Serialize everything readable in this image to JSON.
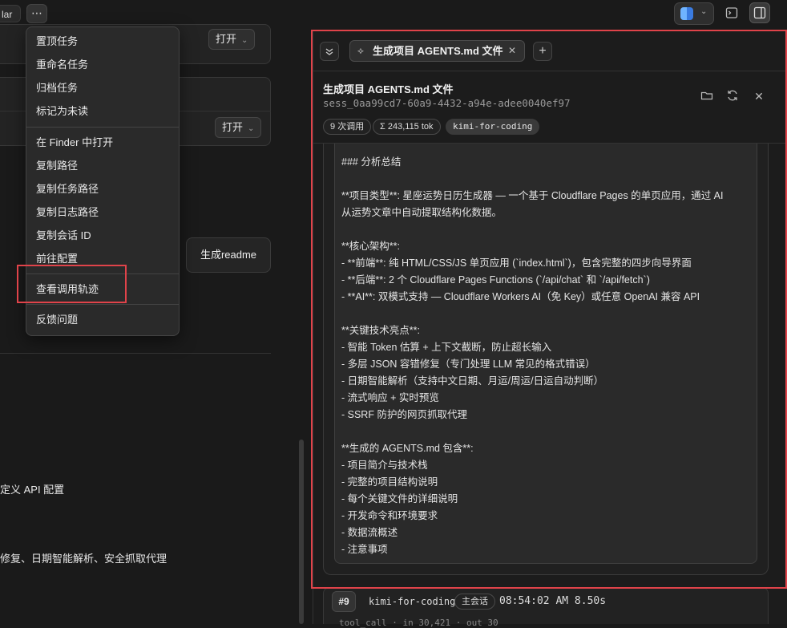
{
  "topbar": {
    "left_fragment": "lar",
    "more_label": "⋯"
  },
  "left": {
    "open_label_1": "打开",
    "open_label_2": "打开",
    "readme_button": "生成readme",
    "text_line_1": "定义 API 配置",
    "text_line_2": "修复、日期智能解析、安全抓取代理"
  },
  "menu": {
    "items": [
      "置顶任务",
      "重命名任务",
      "归档任务",
      "标记为未读",
      "在 Finder 中打开",
      "复制路径",
      "复制任务路径",
      "复制日志路径",
      "复制会话 ID",
      "前往配置",
      "查看调用轨迹",
      "反馈问题"
    ]
  },
  "panel": {
    "tab_label": "生成项目 AGENTS.md 文件",
    "session_title": "生成项目 AGENTS.md 文件",
    "session_id": "sess_0aa99cd7-60a9-4432-a94e-adee0040ef97",
    "badges": {
      "calls": "9 次调用",
      "tokens": "Σ 243,115 tok",
      "model": "kimi-for-coding"
    },
    "content_lines": [
      "### 分析总结",
      "",
      "**项目类型**: 星座运势日历生成器 — 一个基于 Cloudflare Pages 的单页应用，通过 AI",
      "从运势文章中自动提取结构化数据。",
      "",
      "**核心架构**:",
      "- **前端**: 纯 HTML/CSS/JS 单页应用 (`index.html`)，包含完整的四步向导界面",
      "- **后端**: 2 个 Cloudflare Pages Functions (`/api/chat` 和 `/api/fetch`)",
      "- **AI**: 双模式支持 — Cloudflare Workers AI（免 Key）或任意 OpenAI 兼容 API",
      "",
      "**关键技术亮点**:",
      "- 智能 Token 估算 + 上下文截断，防止超长输入",
      "- 多层 JSON 容错修复（专门处理 LLM 常见的格式错误）",
      "- 日期智能解析（支持中文日期、月运/周运/日运自动判断）",
      "- 流式响应 + 实时预览",
      "- SSRF 防护的网页抓取代理",
      "",
      "**生成的 AGENTS.md 包含**:",
      "- 项目简介与技术栈",
      "- 完整的项目结构说明",
      "- 每个关键文件的详细说明",
      "- 开发命令和环境要求",
      "- 数据流概述",
      "- 注意事项"
    ],
    "run": {
      "number": "#9",
      "model": "kimi-for-coding",
      "tag": "主会话",
      "time": "08:54:02 AM 8.50s",
      "sub": "tool_call · in 30,421 · out 30"
    }
  },
  "colors": {
    "highlight": "#e0434a",
    "background": "#1a1a1a"
  }
}
